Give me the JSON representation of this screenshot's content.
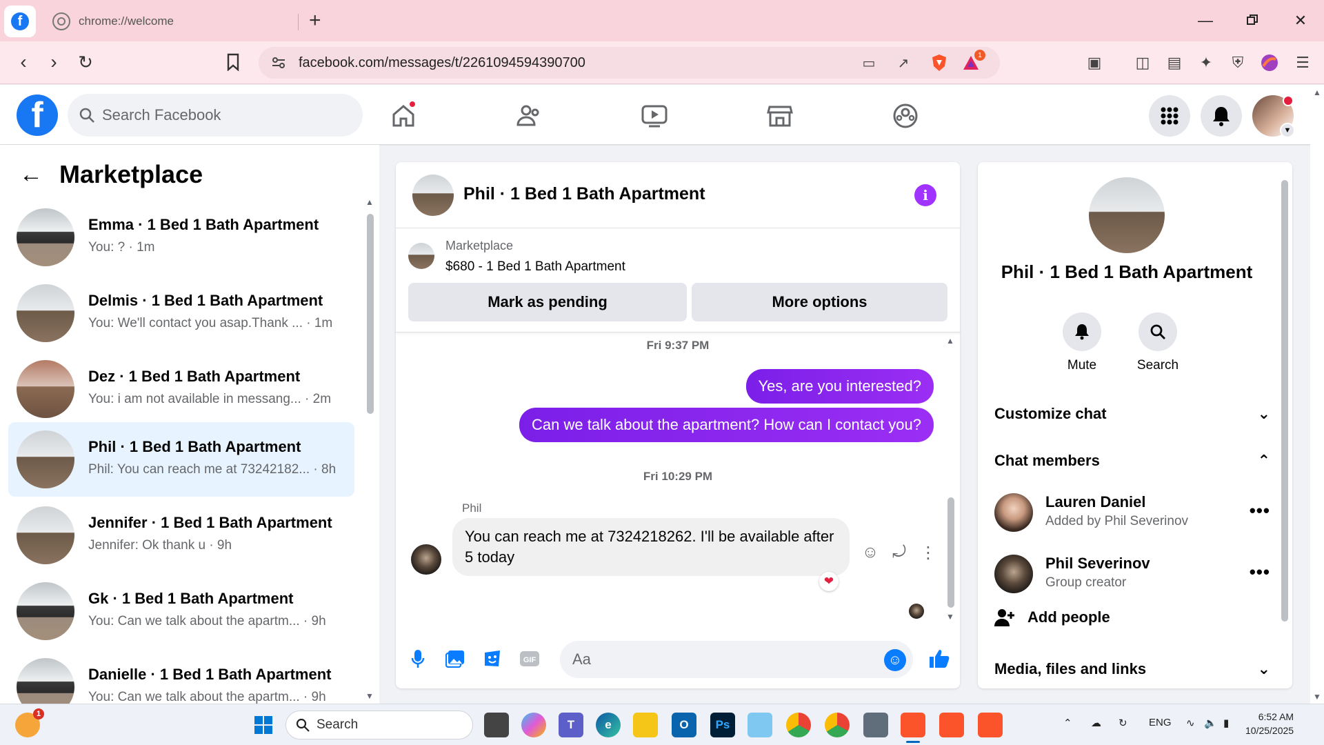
{
  "browser": {
    "tab_title": "chrome://welcome",
    "url": "facebook.com/messages/t/2261094594390700",
    "reward_badge": "1"
  },
  "facebook": {
    "logo_letter": "f",
    "search_placeholder": "Search Facebook"
  },
  "left_panel": {
    "title": "Marketplace",
    "conversations": [
      {
        "name": "Emma · 1 Bed 1 Bath Apartment",
        "preview": "You: ? · 1m"
      },
      {
        "name": "Delmis · 1 Bed 1 Bath Apartment",
        "preview": "You: We'll contact you asap.Thank ... · 1m"
      },
      {
        "name": "Dez · 1 Bed 1 Bath Apartment",
        "preview": "You: i am not available in messang... · 2m"
      },
      {
        "name": "Phil · 1 Bed 1 Bath Apartment",
        "preview": "Phil: You can reach me at 73242182... · 8h"
      },
      {
        "name": "Jennifer · 1 Bed 1 Bath Apartment",
        "preview": "Jennifer: Ok thank u · 9h"
      },
      {
        "name": "Gk · 1 Bed 1 Bath Apartment",
        "preview": "You: Can we talk about the apartm... · 9h"
      },
      {
        "name": "Danielle · 1 Bed 1 Bath Apartment",
        "preview": "You: Can we talk about the apartm... · 9h"
      }
    ]
  },
  "chat": {
    "title": "Phil · 1 Bed 1 Bath Apartment",
    "marketplace_label": "Marketplace",
    "listing": "$680 - 1 Bed 1 Bath Apartment",
    "mark_pending_label": "Mark as pending",
    "more_options_label": "More options",
    "timestamp1": "Fri 9:37 PM",
    "out_msg1": "Yes, are you interested?",
    "out_msg2": "Can we talk about the apartment? How can I contact you?",
    "timestamp2": "Fri 10:29 PM",
    "sender": "Phil",
    "in_msg": "You can reach me at 7324218262. I'll be available after 5 today",
    "reaction": "❤",
    "composer_placeholder": "Aa"
  },
  "info": {
    "name": "Phil · 1 Bed 1 Bath Apartment",
    "mute_label": "Mute",
    "search_label": "Search",
    "customize_label": "Customize chat",
    "members_label": "Chat members",
    "members": [
      {
        "name": "Lauren Daniel",
        "sub": "Added by Phil Severinov"
      },
      {
        "name": "Phil Severinov",
        "sub": "Group creator"
      }
    ],
    "add_people_label": "Add people",
    "media_label": "Media, files and links"
  },
  "taskbar": {
    "search_label": "Search",
    "lang": "ENG",
    "time": "6:52 AM",
    "date": "10/25/2025",
    "weather_badge": "1"
  },
  "colors": {
    "brand_blue": "#1877f2",
    "messenger_purple": "#8a2be2",
    "selected_row": "#e7f3ff"
  }
}
